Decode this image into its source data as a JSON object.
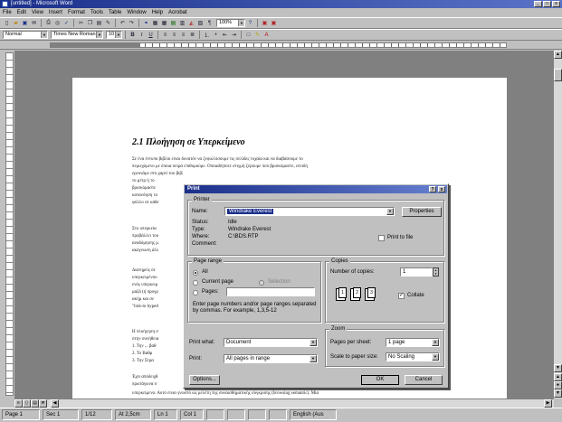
{
  "window": {
    "title": "[untitled] - Microsoft Word",
    "min": "_",
    "max": "□",
    "close": "x"
  },
  "menu": [
    "File",
    "Edit",
    "View",
    "Insert",
    "Format",
    "Tools",
    "Table",
    "Window",
    "Help",
    "Acrobat"
  ],
  "toolbar": {
    "zoom": "100%"
  },
  "format_bar": {
    "style": "Normal",
    "font": "Times New Roman",
    "size": "10",
    "bold": "B",
    "italic": "I",
    "underline": "U"
  },
  "document": {
    "heading": "2.1 Πλοήγηση σε Υπερκείμενο",
    "para1": [
      "Σε ένα έντυπο βιβλίο είναι δυνατόν να ξεφυλλίσουμε τις σελίδες τυχαία και να διαβάσουμε το",
      "περιεχόμενο με όποια σειρά επιθυμούμε. Οποιαδήποτε στιγμή ξέρουμε πού βρισκόμαστε, επειδή",
      "ερευνάμε στο χαρτί του βιβλίου, υπάρχουν",
      "το μέτρ ή το",
      "βρισκόμαστε",
      "κατανόηση το",
      "φύλλο σε κάθε"
    ],
    "para2": [
      "Στο υπερκεία",
      "προβάλλει του",
      "αναδόμησης μ",
      "ακόγνωση άλλ"
    ],
    "para3": [
      "Διατηρείς σε",
      "υπερκειμένου",
      "ενός υπερκειμ",
      "μαζά (ή προγρ",
      "ακήμ και σε",
      "\"link-to hyperl"
    ],
    "para4_lines": [
      "Η πλοήγηση σ",
      "στην συνήθεια",
      "1.  Την ... βαθ",
      "2.  Το Βαθμ",
      "3.  Την Στρα"
    ],
    "para5": [
      "Έχει αποδειχθ",
      "πρωτάγωνα σ",
      "υπερκείμενο. Αυτό είναι γνωστό ως μελέτη της συναισθηματικής σύγκρισης (browsing semantic). Μία"
    ]
  },
  "print_dialog": {
    "title": "Print",
    "help": "?",
    "close": "x",
    "printer_group": "Printer",
    "name_label": "Name:",
    "printer_name": "Windrake Everest",
    "properties": "Properties",
    "status_label": "Status:",
    "status_value": "Idle",
    "type_label": "Type:",
    "type_value": "Windrake Everest",
    "where_label": "Where:",
    "where_value": "C:\\BDS.RTP",
    "comment_label": "Comment:",
    "print_to_file": "Print to file",
    "page_range_group": "Page range",
    "all": "All",
    "current_page": "Current page",
    "selection": "Selection",
    "pages": "Pages:",
    "hint": "Enter page numbers and/or page ranges separated by commas. For example, 1,3,5-12",
    "copies_group": "Copies",
    "num_copies_label": "Number of copies:",
    "num_copies": "1",
    "collate": "Collate",
    "print_what_label": "Print what:",
    "print_what": "Document",
    "print_label": "Print:",
    "print_value": "All pages in range",
    "zoom_group": "Zoom",
    "pages_per_sheet_label": "Pages per sheet:",
    "pages_per_sheet": "1 page",
    "scale_label": "Scale to paper size:",
    "scale_value": "No Scaling",
    "options": "Options...",
    "ok": "OK",
    "cancel": "Cancel"
  },
  "status": {
    "page": "Page 1",
    "sec": "Sec 1",
    "pos": "1/12",
    "at": "At 2,5cm",
    "ln": "Ln 1",
    "col": "Col 1",
    "lang": "English (Aus"
  }
}
